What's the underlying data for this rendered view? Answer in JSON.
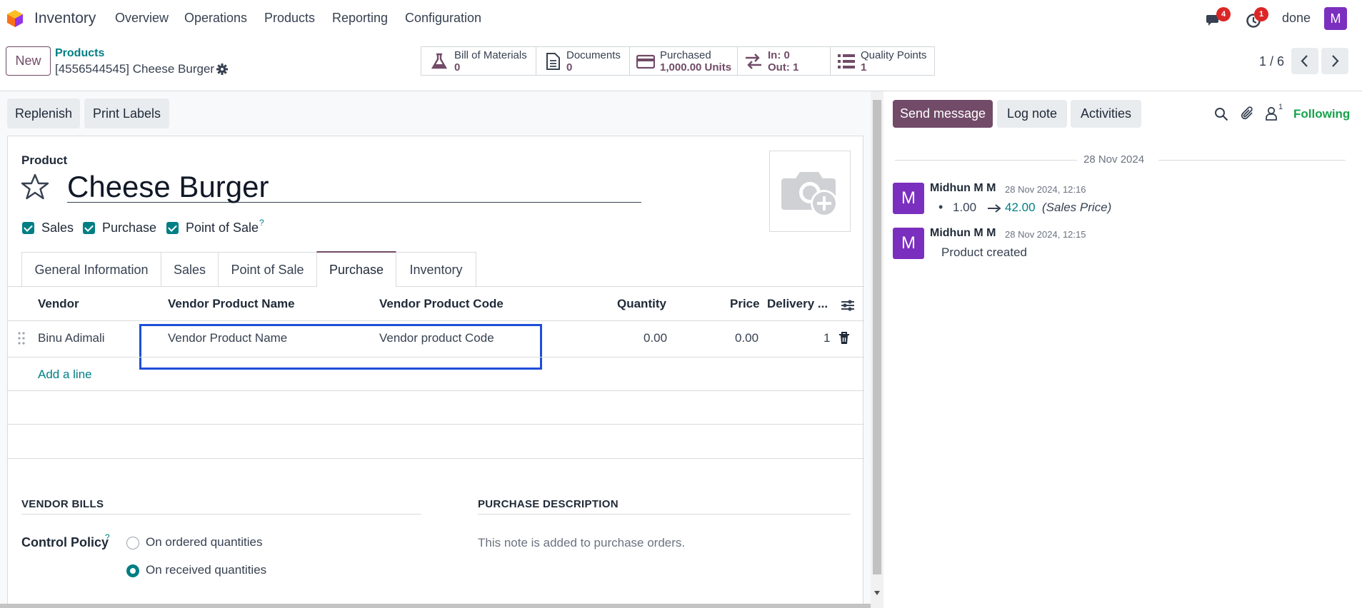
{
  "nav": {
    "app_name": "Inventory",
    "menu": [
      "Overview",
      "Operations",
      "Products",
      "Reporting",
      "Configuration"
    ],
    "messages_badge": "4",
    "activities_badge": "1",
    "company": "done",
    "user_initial": "M"
  },
  "control": {
    "new_label": "New",
    "breadcrumb_parent": "Products",
    "breadcrumb_current": "[4556544545] Cheese Burger",
    "pager": "1 / 6",
    "stats": [
      {
        "label": "Bill of Materials",
        "value": "0",
        "icon": "flask-icon"
      },
      {
        "label": "Documents",
        "value": "0",
        "icon": "document-icon"
      },
      {
        "label": "Purchased",
        "value": "1,000.00 Units",
        "icon": "credit-card-icon"
      },
      {
        "label": "In: 0",
        "value": "Out: 1",
        "icon": "transfer-icon"
      },
      {
        "label": "Quality Points",
        "value": "1",
        "icon": "list-icon"
      }
    ]
  },
  "actions": {
    "replenish": "Replenish",
    "print_labels": "Print Labels"
  },
  "form": {
    "product_label": "Product",
    "product_name": "Cheese Burger",
    "checkboxes": [
      {
        "label": "Sales",
        "checked": true
      },
      {
        "label": "Purchase",
        "checked": true
      },
      {
        "label": "Point of Sale",
        "checked": true,
        "help": "?"
      }
    ],
    "tabs": [
      "General Information",
      "Sales",
      "Point of Sale",
      "Purchase",
      "Inventory"
    ],
    "active_tab": "Purchase",
    "vendor_table": {
      "headers": [
        "Vendor",
        "Vendor Product Name",
        "Vendor Product Code",
        "Quantity",
        "Price",
        "Delivery ..."
      ],
      "rows": [
        {
          "vendor": "Binu Adimali",
          "product_name": "Vendor Product Name",
          "product_code": "Vendor product Code",
          "quantity": "0.00",
          "price": "0.00",
          "delivery": "1"
        }
      ],
      "add_line": "Add a line"
    },
    "vendor_bills_title": "VENDOR BILLS",
    "control_policy_label": "Control Policy",
    "control_policy_help": "?",
    "control_policy_options": [
      {
        "label": "On ordered quantities",
        "selected": false
      },
      {
        "label": "On received quantities",
        "selected": true
      }
    ],
    "purchase_description_title": "PURCHASE DESCRIPTION",
    "purchase_description_placeholder": "This note is added to purchase orders."
  },
  "chatter": {
    "send_message": "Send message",
    "log_note": "Log note",
    "activities": "Activities",
    "followers_count": "1",
    "following": "Following",
    "date_separator": "28 Nov 2024",
    "messages": [
      {
        "author": "Midhun M M",
        "initial": "M",
        "time": "28 Nov 2024, 12:16",
        "old_value": "1.00",
        "new_value": "42.00",
        "field": "(Sales Price)"
      },
      {
        "author": "Midhun M M",
        "initial": "M",
        "time": "28 Nov 2024, 12:15",
        "body": "Product created"
      }
    ]
  },
  "colors": {
    "brand": "#714B67",
    "accent": "#017e84",
    "highlight_box": "#1d4ed8",
    "following": "#16a34a",
    "avatar": "#7b2fbe"
  }
}
